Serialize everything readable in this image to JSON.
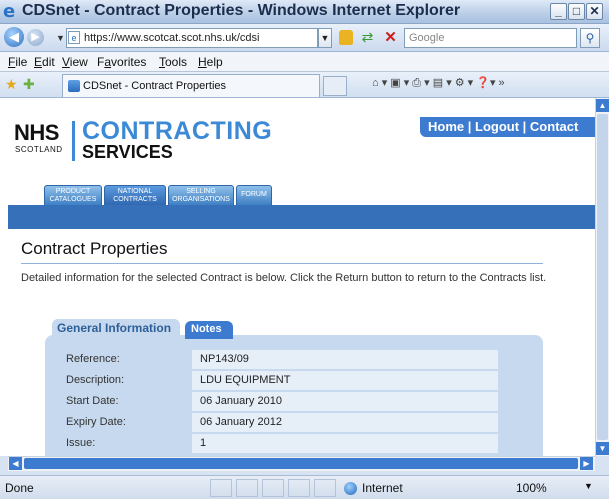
{
  "window": {
    "title": "CDSnet - Contract Properties - Windows Internet Explorer",
    "minimize": "_",
    "maximize": "□",
    "close": "✕"
  },
  "address_bar": {
    "url": "https://www.scotcat.scot.nhs.uk/cdsi",
    "search_placeholder": "Google"
  },
  "menu": [
    {
      "label": "File",
      "accel": "F"
    },
    {
      "label": "Edit",
      "accel": "E"
    },
    {
      "label": "View",
      "accel": "V"
    },
    {
      "label": "Favorites",
      "accel": "a"
    },
    {
      "label": "Tools",
      "accel": "T"
    },
    {
      "label": "Help",
      "accel": "H"
    }
  ],
  "tab": {
    "label": "CDSnet - Contract Properties"
  },
  "site": {
    "nhs_logo": "NHS",
    "nhs_sub": "SCOTLAND",
    "logo_line1": "CONTRACTING",
    "logo_line2": "SERVICES",
    "top_nav": [
      "Home",
      "Logout",
      "Contact"
    ],
    "nav_tabs": [
      {
        "line1": "PRODUCT",
        "line2": "CATALOGUES"
      },
      {
        "line1": "NATIONAL",
        "line2": "CONTRACTS"
      },
      {
        "line1": "SELLING",
        "line2": "ORGANISATIONS"
      },
      {
        "line1": "FORUM",
        "line2": ""
      }
    ]
  },
  "main": {
    "page_title": "Contract Properties",
    "intro": "Detailed information for the selected Contract is below.  Click the Return button to return to the Contracts list.",
    "tabs": [
      "General Information",
      "Notes"
    ],
    "properties": [
      {
        "label": "Reference:",
        "value": "NP143/09"
      },
      {
        "label": "Description:",
        "value": "LDU EQUIPMENT"
      },
      {
        "label": "Start Date:",
        "value": "06 January 2010"
      },
      {
        "label": "Expiry Date:",
        "value": "06 January 2012"
      },
      {
        "label": "Issue:",
        "value": "1"
      }
    ]
  },
  "status": {
    "text": "Done",
    "zone": "Internet",
    "zoom": "100%"
  }
}
